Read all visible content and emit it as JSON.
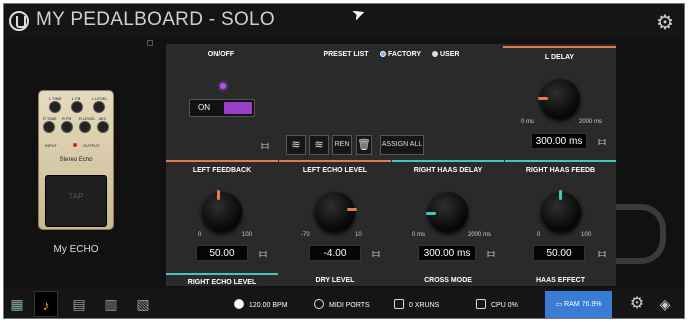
{
  "header": {
    "title": "MY PEDALBOARD - SOLO"
  },
  "pedal": {
    "name": "Stereo Echo",
    "footswitch_label": "TAP",
    "jack_input": "INPUT",
    "jack_output": "OUTPUT",
    "knob_labels": [
      "L TIME",
      "L FB",
      "L LEVEL",
      "R TIME",
      "R FB",
      "R LEVEL",
      "MIX"
    ],
    "label": "My ECHO"
  },
  "panel": {
    "onoff": {
      "title": "ON/OFF",
      "toggle_label": "ON"
    },
    "preset": {
      "title": "PRESET LIST",
      "options": [
        "FACTORY",
        "USER"
      ],
      "selected": "FACTORY",
      "ren_label": "REN",
      "assign_all_label": "ASSIGN ALL"
    },
    "l_delay": {
      "title": "L DELAY",
      "min": "0 ms",
      "max": "2000 ms",
      "value": "300.00 ms"
    },
    "left_feedback": {
      "title": "LEFT FEEDBACK",
      "min": "0",
      "max": "100",
      "value": "50.00"
    },
    "left_echo_level": {
      "title": "LEFT ECHO LEVEL",
      "min": "-70",
      "max": "10",
      "value": "-4.00"
    },
    "right_haas_delay": {
      "title": "RIGHT HAAS DELAY",
      "min": "0 ms",
      "max": "2000 ms",
      "value": "300.00 ms"
    },
    "right_haas_feedb": {
      "title": "RIGHT HAAS FEEDB",
      "min": "0",
      "max": "100",
      "value": "50.00"
    },
    "row3": [
      "RIGHT ECHO LEVEL",
      "DRY LEVEL",
      "CROSS MODE",
      "HAAS EFFECT"
    ]
  },
  "statusbar": {
    "bpm": "120.00 BPM",
    "midi": "MIDI PORTS",
    "xruns": "0 XRUNS",
    "cpu": "CPU 0%",
    "ram": "RAM 76.9%"
  },
  "colors": {
    "accent_orange": "#e07a55",
    "accent_teal": "#3cc7c0",
    "toggle_purple": "#9b3fc9",
    "ram_blue": "#3a7bd5"
  }
}
